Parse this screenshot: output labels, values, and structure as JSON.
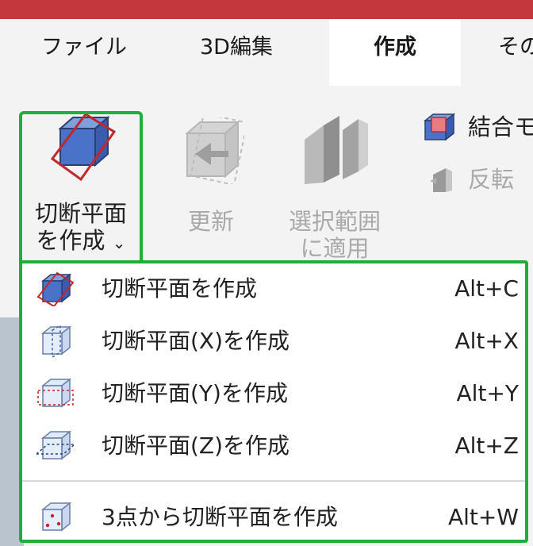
{
  "tabs": [
    {
      "label": "ファイル",
      "active": false
    },
    {
      "label": "3D編集",
      "active": false
    },
    {
      "label": "作成",
      "active": true
    },
    {
      "label": "その",
      "active": false
    }
  ],
  "ribbon": {
    "create_section": {
      "label_line1": "切断平面",
      "label_line2": "を作成",
      "chevron": "⌄"
    },
    "update": {
      "label": "更新",
      "enabled": false
    },
    "apply_selection": {
      "label_line1": "選択範囲",
      "label_line2": "に適用",
      "enabled": false
    },
    "combine": {
      "label": "結合モ"
    },
    "invert": {
      "label": "反転",
      "enabled": false
    }
  },
  "menu": {
    "items": [
      {
        "label": "切断平面を作成",
        "shortcut": "Alt+C",
        "icon": "section-plane-icon"
      },
      {
        "label": "切断平面(X)を作成",
        "shortcut": "Alt+X",
        "icon": "section-plane-x-icon"
      },
      {
        "label": "切断平面(Y)を作成",
        "shortcut": "Alt+Y",
        "icon": "section-plane-y-icon"
      },
      {
        "label": "切断平面(Z)を作成",
        "shortcut": "Alt+Z",
        "icon": "section-plane-z-icon"
      },
      {
        "label": "3点から切断平面を作成",
        "shortcut": "Alt+W",
        "icon": "section-plane-3point-icon"
      }
    ]
  },
  "colors": {
    "title_bar": "#c4373c",
    "highlight": "#1fad3b",
    "cube_blue": "#4a72c8",
    "plane_red": "#c0282d"
  }
}
